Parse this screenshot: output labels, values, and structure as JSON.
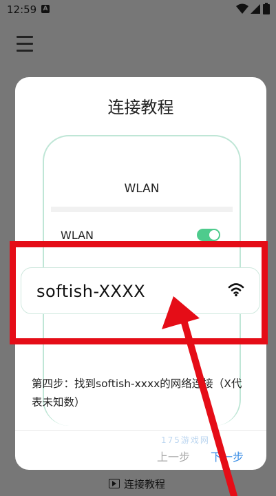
{
  "status_bar": {
    "time": "12:59",
    "notif_glyph": "A"
  },
  "dialog": {
    "title": "连接教程",
    "phone": {
      "title": "WLAN",
      "row_label": "WLAN",
      "toggle_on": true
    },
    "network": {
      "name": "softish-XXXX",
      "icon": "wifi-icon"
    },
    "step_text": "第四步：找到softish-xxxx的网络连接（X代表未知数）",
    "prev_label": "上一步",
    "next_label": "下一步",
    "watermark": "175游戏网"
  },
  "bottom_link": {
    "label": "连接教程",
    "icon": "play-icon"
  },
  "colors": {
    "highlight": "#e50d17",
    "arrow": "#e50d17",
    "toggle": "#4ecb8d",
    "next": "#3a8ee6"
  }
}
